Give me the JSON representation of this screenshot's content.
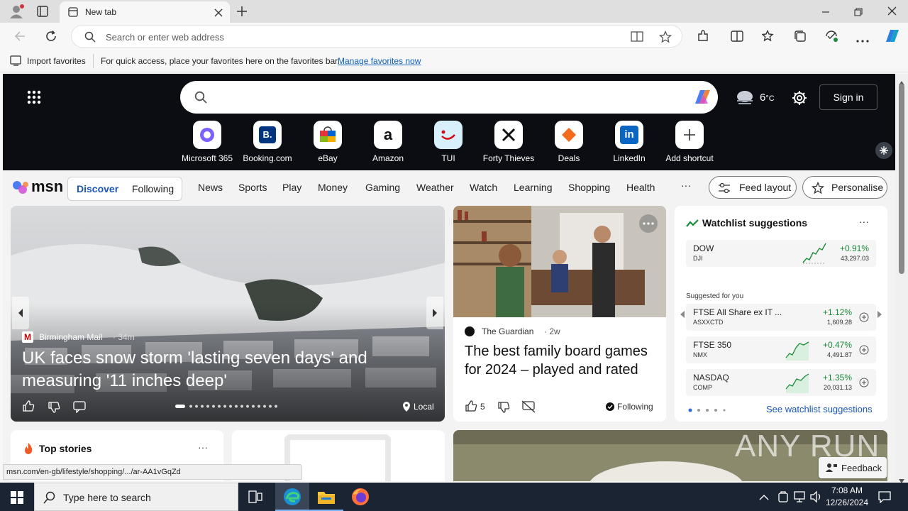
{
  "browser": {
    "tab_title": "New tab",
    "address_placeholder": "Search or enter web address",
    "favorites_import": "Import favorites",
    "favorites_hint": "For quick access, place your favorites here on the favorites bar.",
    "favorites_link": "Manage favorites now"
  },
  "msn": {
    "weather_temp": "6",
    "weather_unit": "°C",
    "sign_in": "Sign in",
    "shortcuts": [
      {
        "label": "Microsoft 365",
        "icon": "microsoft365-icon",
        "color": "#7b61ff"
      },
      {
        "label": "Booking.com",
        "icon": "booking-icon",
        "color": "#003580"
      },
      {
        "label": "eBay",
        "icon": "ebay-icon",
        "color": "#e53238"
      },
      {
        "label": "Amazon",
        "icon": "amazon-icon",
        "color": "#000000"
      },
      {
        "label": "TUI",
        "icon": "tui-icon",
        "color": "#d40e14"
      },
      {
        "label": "Forty Thieves",
        "icon": "forty-thieves-icon",
        "color": "#111111"
      },
      {
        "label": "Deals",
        "icon": "deals-icon",
        "color": "#f26b1d"
      },
      {
        "label": "LinkedIn",
        "icon": "linkedin-icon",
        "color": "#0a66c2"
      },
      {
        "label": "Add shortcut",
        "icon": "add-icon",
        "color": "#333333"
      }
    ],
    "logo": "msn",
    "discover": "Discover",
    "following": "Following",
    "nav": [
      "News",
      "Sports",
      "Play",
      "Money",
      "Gaming",
      "Weather",
      "Watch",
      "Learning",
      "Shopping",
      "Health"
    ],
    "more": "···",
    "feed_layout": "Feed layout",
    "personalise": "Personalise"
  },
  "hero_story": {
    "source": "Birmingham Mail",
    "age": "· 34m",
    "title": "UK faces snow storm 'lasting seven days' and measuring '11 inches deep'",
    "local": "Local"
  },
  "guardian_story": {
    "source": "The Guardian",
    "age": "· 2w",
    "title": "The best family board games for 2024 – played and rated",
    "likes": "5",
    "following": "Following"
  },
  "watchlist": {
    "title": "Watchlist suggestions",
    "more": "···",
    "suggested_label": "Suggested for you",
    "see_more": "See watchlist suggestions",
    "main": {
      "name": "DOW",
      "code": "DJI",
      "change": "+0.91%",
      "value": "43,297.03"
    },
    "items": [
      {
        "name": "FTSE All Share ex IT ...",
        "code": "ASXXCTD",
        "change": "+1.12%",
        "value": "1,609.28"
      },
      {
        "name": "FTSE 350",
        "code": "NMX",
        "change": "+0.47%",
        "value": "4,491.87"
      },
      {
        "name": "NASDAQ",
        "code": "COMP",
        "change": "+1.35%",
        "value": "20,031.13"
      }
    ]
  },
  "top_stories": {
    "title": "Top stories",
    "more": "···"
  },
  "status_url": "msn.com/en-gb/lifestyle/shopping/.../ar-AA1vGqZd",
  "feedback": "Feedback",
  "watermark": "ANY RUN",
  "taskbar": {
    "search_placeholder": "Type here to search",
    "time": "7:08 AM",
    "date": "12/26/2024"
  }
}
